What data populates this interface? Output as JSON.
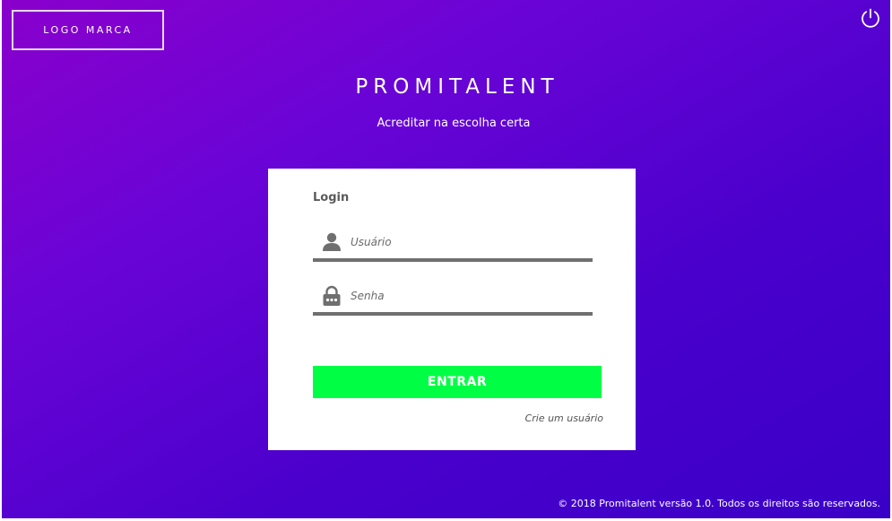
{
  "header": {
    "logo_text": "LOGO MARCA",
    "title": "PROMITALENT",
    "subtitle": "Acreditar na escolha certa",
    "power_icon": "power-icon"
  },
  "login": {
    "title": "Login",
    "username": {
      "placeholder": "Usuário",
      "value": "",
      "icon": "user-icon"
    },
    "password": {
      "placeholder": "Senha",
      "value": "",
      "icon": "lock-icon"
    },
    "submit_label": "ENTRAR",
    "create_user_link": "Crie um usuário"
  },
  "footer": {
    "copyright": "© 2018 Promitalent versão 1.0. Todos os direitos são reservados."
  },
  "colors": {
    "gradient_start": "#8a00cc",
    "gradient_end": "#3a00c8",
    "button": "#00ff44",
    "field_underline": "#6f6f6f",
    "card": "#ffffff"
  }
}
